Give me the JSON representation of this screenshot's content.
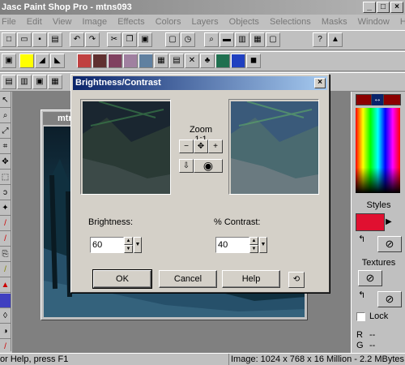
{
  "app": {
    "title": "Jasc Paint Shop Pro - mtns093",
    "caption_buttons": [
      "_",
      "□",
      "×"
    ]
  },
  "menu": [
    "File",
    "Edit",
    "View",
    "Image",
    "Effects",
    "Colors",
    "Layers",
    "Objects",
    "Selections",
    "Masks",
    "Window",
    "Help"
  ],
  "image_window": {
    "title": "mtns"
  },
  "dialog": {
    "title": "Brightness/Contrast",
    "zoom_label": "Zoom 1:1",
    "brightness": {
      "label": "Brightness:",
      "value": "60"
    },
    "contrast": {
      "label": "% Contrast:",
      "value": "40"
    },
    "buttons": {
      "ok": "OK",
      "cancel": "Cancel",
      "help": "Help"
    }
  },
  "right_palette": {
    "styles_label": "Styles",
    "textures_label": "Textures",
    "lock_label": "Lock",
    "r_label": "R",
    "g_label": "G",
    "r_value": "--",
    "g_value": "--",
    "colors": {
      "foreground": "#8b0000",
      "background": "#8b0000",
      "style_swatch": "#e01030"
    }
  },
  "status": {
    "left": "or Help, press F1",
    "right": "Image:  1024 x 768 x 16 Million - 2.2 MBytes"
  }
}
